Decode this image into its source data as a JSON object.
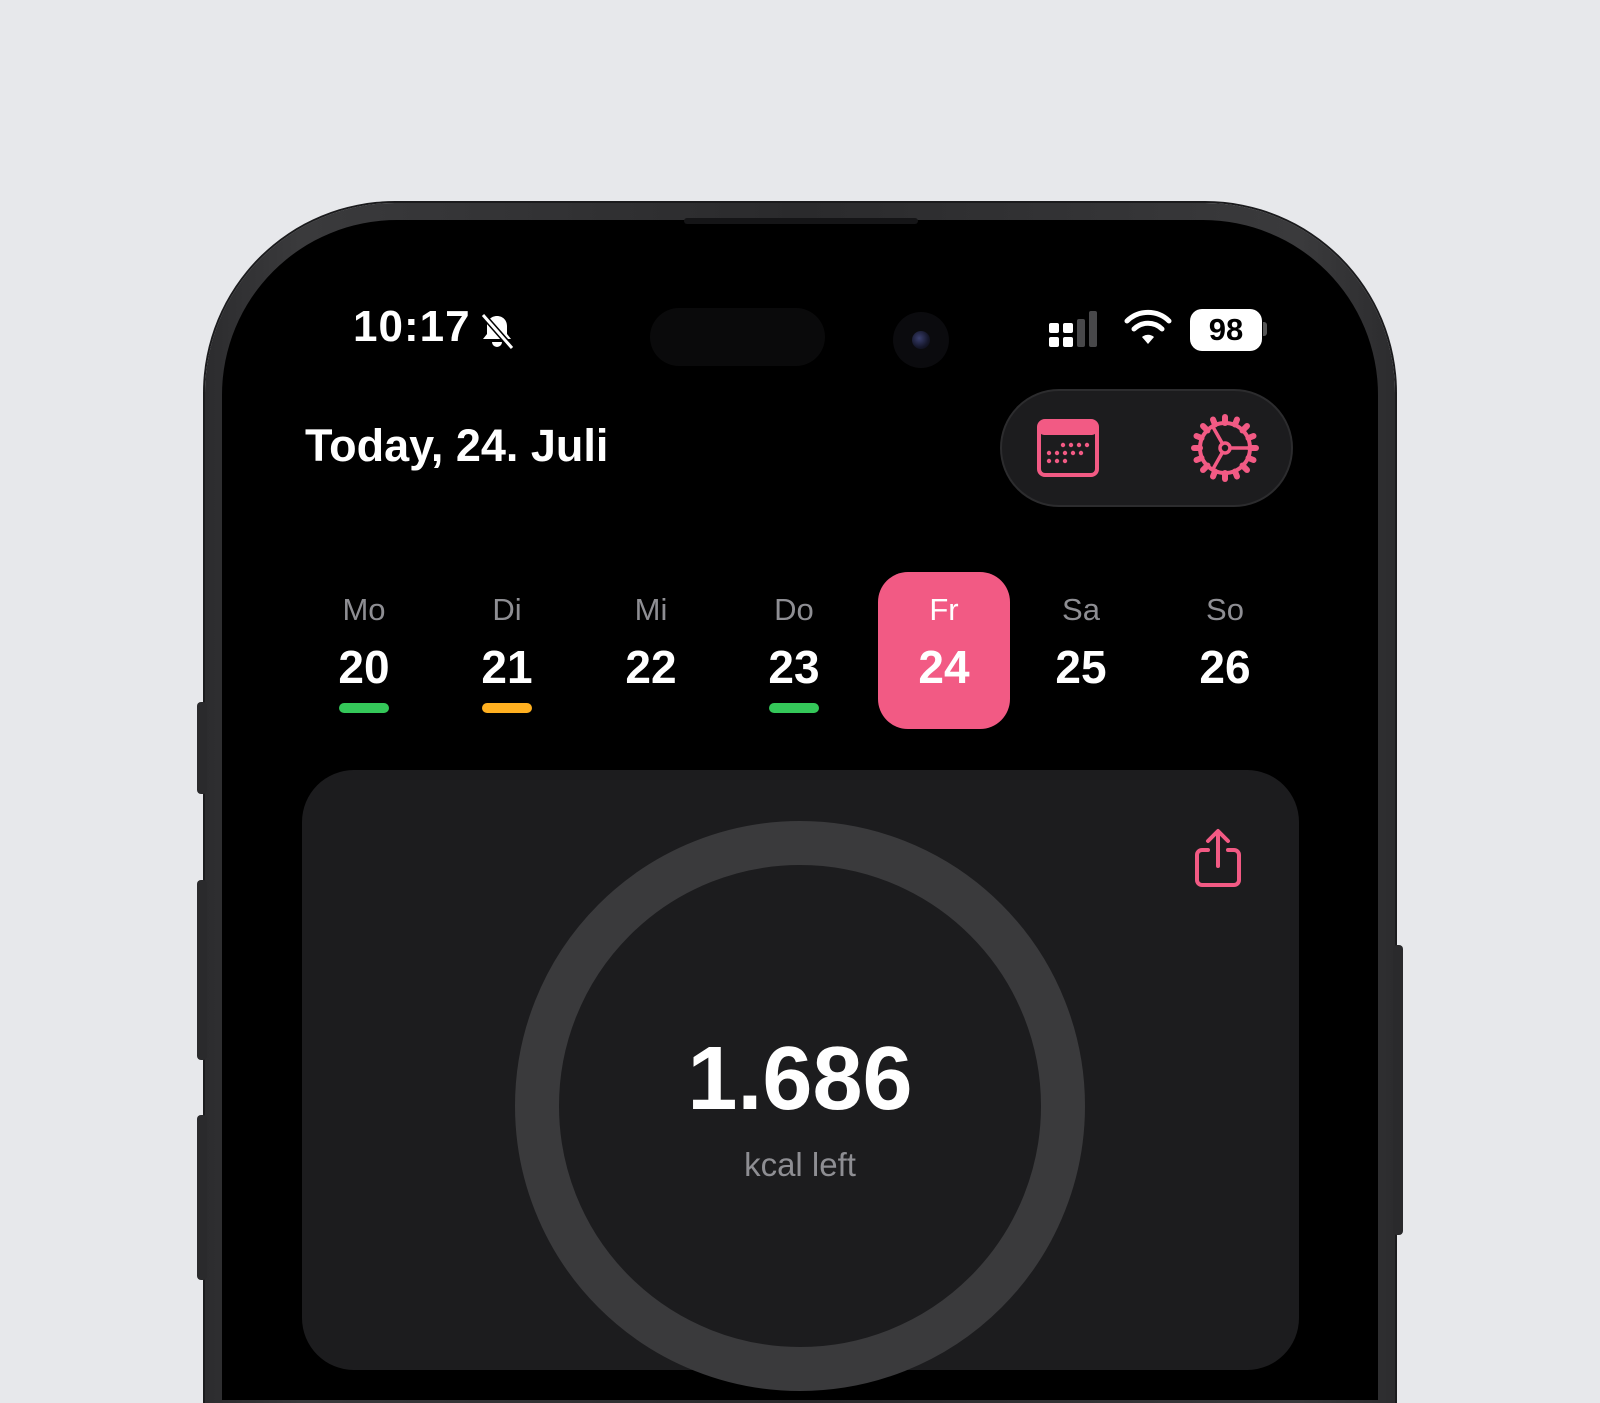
{
  "status_bar": {
    "time": "10:17",
    "battery": "98",
    "icons": [
      "bell-slash-icon",
      "signal-icon",
      "wifi-icon",
      "battery-icon"
    ]
  },
  "header": {
    "title": "Today, 24. Juli",
    "actions": [
      {
        "name": "calendar-icon",
        "color": "#f25a84"
      },
      {
        "name": "gear-icon",
        "color": "#f25a84"
      }
    ]
  },
  "week": {
    "days": [
      {
        "dow": "Mo",
        "date": "20",
        "status": "green"
      },
      {
        "dow": "Di",
        "date": "21",
        "status": "orange"
      },
      {
        "dow": "Mi",
        "date": "22",
        "status": "none"
      },
      {
        "dow": "Do",
        "date": "23",
        "status": "green"
      },
      {
        "dow": "Fr",
        "date": "24",
        "status": "selected"
      },
      {
        "dow": "Sa",
        "date": "25",
        "status": "none"
      },
      {
        "dow": "So",
        "date": "26",
        "status": "none"
      }
    ]
  },
  "summary": {
    "kcal_value": "1.686",
    "kcal_label": "kcal left",
    "share_icon": "share-icon"
  },
  "colors": {
    "accent": "#f25a84",
    "green": "#34c759",
    "orange": "#ffb020",
    "card": "#1c1c1e",
    "ring_track": "#3a3a3c"
  }
}
